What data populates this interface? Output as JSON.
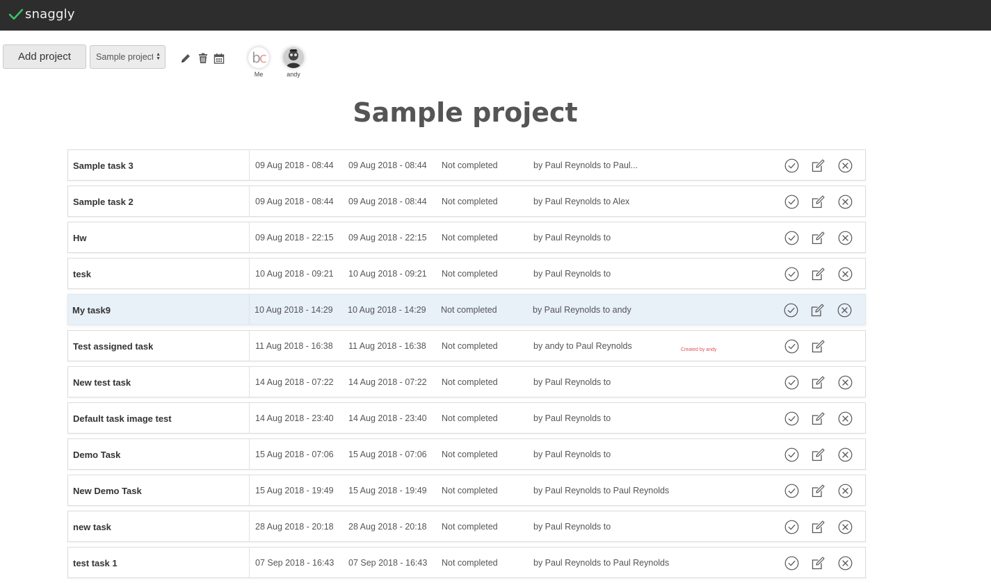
{
  "app": {
    "name": "snaggly"
  },
  "toolbar": {
    "add_project_label": "Add project",
    "project_select_value": "Sample project",
    "icons": [
      "pencil-icon",
      "trash-icon",
      "calendar-icon"
    ]
  },
  "members": [
    {
      "initials_a": "b",
      "initials_b": "c",
      "name": "Me"
    },
    {
      "name": "andy"
    }
  ],
  "project_title": "Sample project",
  "colors": {
    "topbar": "#2d2d2d",
    "logo_check": "#3ec46d",
    "selected_row": "#e8f0f8",
    "note": "#e0505a"
  },
  "tasks": [
    {
      "name": "Sample task 3",
      "start": "09 Aug 2018 - 08:44",
      "end": "09 Aug 2018 - 08:44",
      "status": "Not completed",
      "assign": "by Paul Reynolds to Paul...",
      "note": "",
      "can_delete": true,
      "selected": false
    },
    {
      "name": "Sample task 2",
      "start": "09 Aug 2018 - 08:44",
      "end": "09 Aug 2018 - 08:44",
      "status": "Not completed",
      "assign": "by Paul Reynolds to Alex",
      "note": "",
      "can_delete": true,
      "selected": false
    },
    {
      "name": "Hw",
      "start": "09 Aug 2018 - 22:15",
      "end": "09 Aug 2018 - 22:15",
      "status": "Not completed",
      "assign": "by Paul Reynolds to",
      "note": "",
      "can_delete": true,
      "selected": false
    },
    {
      "name": "tesk",
      "start": "10 Aug 2018 - 09:21",
      "end": "10 Aug 2018 - 09:21",
      "status": "Not completed",
      "assign": "by Paul Reynolds to",
      "note": "",
      "can_delete": true,
      "selected": false
    },
    {
      "name": "My task9",
      "start": "10 Aug 2018 - 14:29",
      "end": "10 Aug 2018 - 14:29",
      "status": "Not completed",
      "assign": "by Paul Reynolds to andy",
      "note": "",
      "can_delete": true,
      "selected": true
    },
    {
      "name": "Test assigned task",
      "start": "11 Aug 2018 - 16:38",
      "end": "11 Aug 2018 - 16:38",
      "status": "Not completed",
      "assign": "by andy to Paul Reynolds",
      "note": "Created by andy",
      "can_delete": false,
      "selected": false
    },
    {
      "name": "New test task",
      "start": "14 Aug 2018 - 07:22",
      "end": "14 Aug 2018 - 07:22",
      "status": "Not completed",
      "assign": "by Paul Reynolds to",
      "note": "",
      "can_delete": true,
      "selected": false
    },
    {
      "name": "Default task image test",
      "start": "14 Aug 2018 - 23:40",
      "end": "14 Aug 2018 - 23:40",
      "status": "Not completed",
      "assign": "by Paul Reynolds to",
      "note": "",
      "can_delete": true,
      "selected": false
    },
    {
      "name": "Demo Task",
      "start": "15 Aug 2018 - 07:06",
      "end": "15 Aug 2018 - 07:06",
      "status": "Not completed",
      "assign": "by Paul Reynolds to",
      "note": "",
      "can_delete": true,
      "selected": false
    },
    {
      "name": "New Demo Task",
      "start": "15 Aug 2018 - 19:49",
      "end": "15 Aug 2018 - 19:49",
      "status": "Not completed",
      "assign": "by Paul Reynolds to Paul Reynolds",
      "note": "",
      "can_delete": true,
      "selected": false
    },
    {
      "name": "new task",
      "start": "28 Aug 2018 - 20:18",
      "end": "28 Aug 2018 - 20:18",
      "status": "Not completed",
      "assign": "by Paul Reynolds to",
      "note": "",
      "can_delete": true,
      "selected": false
    },
    {
      "name": "test task 1",
      "start": "07 Sep 2018 - 16:43",
      "end": "07 Sep 2018 - 16:43",
      "status": "Not completed",
      "assign": "by Paul Reynolds to Paul Reynolds",
      "note": "",
      "can_delete": true,
      "selected": false
    }
  ]
}
